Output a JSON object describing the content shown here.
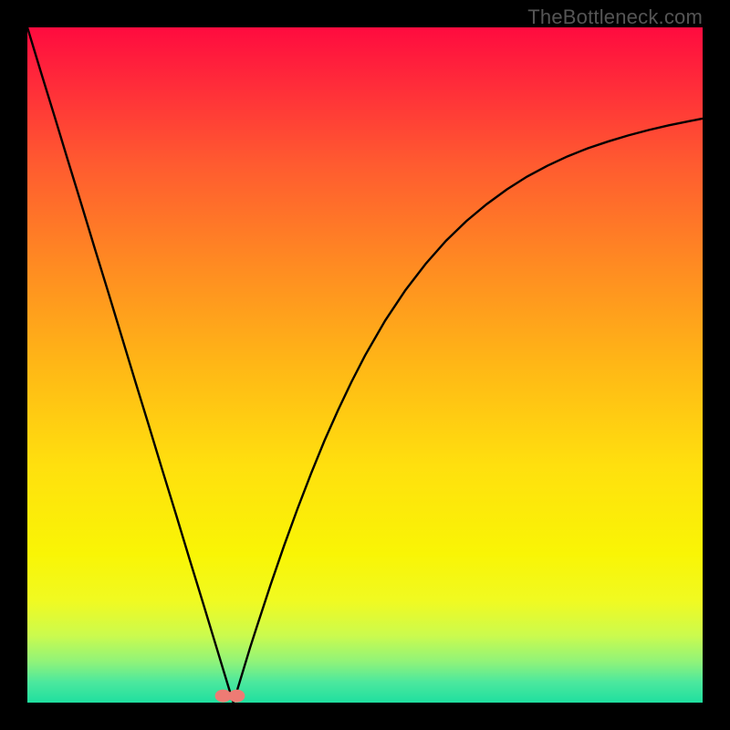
{
  "watermark": "TheBottleneck.com",
  "chart_data": {
    "type": "line",
    "title": "",
    "xlabel": "",
    "ylabel": "",
    "xlim": [
      0,
      100
    ],
    "ylim": [
      0,
      100
    ],
    "grid": false,
    "legend": false,
    "x": [
      0,
      2,
      4,
      6,
      8,
      10,
      12,
      14,
      16,
      18,
      20,
      22,
      24,
      26,
      28,
      29,
      30,
      30.5,
      31,
      32,
      33,
      34,
      36,
      38,
      40,
      42,
      44,
      46,
      48,
      50,
      53,
      56,
      59,
      62,
      65,
      68,
      71,
      74,
      77,
      80,
      83,
      86,
      89,
      92,
      95,
      98,
      100
    ],
    "values": [
      100,
      93.4,
      86.9,
      80.3,
      73.8,
      67.2,
      60.7,
      54.1,
      47.5,
      41.0,
      34.4,
      27.9,
      21.3,
      14.8,
      8.2,
      4.9,
      1.6,
      0.0,
      1.6,
      4.9,
      8.2,
      11.3,
      17.4,
      23.2,
      28.7,
      33.9,
      38.8,
      43.3,
      47.5,
      51.4,
      56.6,
      61.1,
      65.0,
      68.4,
      71.3,
      73.8,
      76.0,
      77.9,
      79.5,
      80.9,
      82.1,
      83.1,
      84.0,
      84.8,
      85.5,
      86.1,
      86.5
    ],
    "sweet_spot_x": 30.5,
    "markers": [
      {
        "x": 29.0,
        "y": 1.0
      },
      {
        "x": 31.0,
        "y": 1.0
      }
    ],
    "marker_color": "#ee7b74",
    "curve_color": "#000000",
    "gradient_stops": [
      {
        "offset": 0.0,
        "color": "#ff0b3f"
      },
      {
        "offset": 0.08,
        "color": "#ff2a3a"
      },
      {
        "offset": 0.2,
        "color": "#ff5a30"
      },
      {
        "offset": 0.35,
        "color": "#ff8a22"
      },
      {
        "offset": 0.5,
        "color": "#ffb716"
      },
      {
        "offset": 0.65,
        "color": "#ffe00e"
      },
      {
        "offset": 0.78,
        "color": "#f9f505"
      },
      {
        "offset": 0.85,
        "color": "#f0fa22"
      },
      {
        "offset": 0.9,
        "color": "#ccfb4d"
      },
      {
        "offset": 0.94,
        "color": "#8ff37a"
      },
      {
        "offset": 0.97,
        "color": "#4be89e"
      },
      {
        "offset": 1.0,
        "color": "#1fdf9f"
      }
    ]
  }
}
